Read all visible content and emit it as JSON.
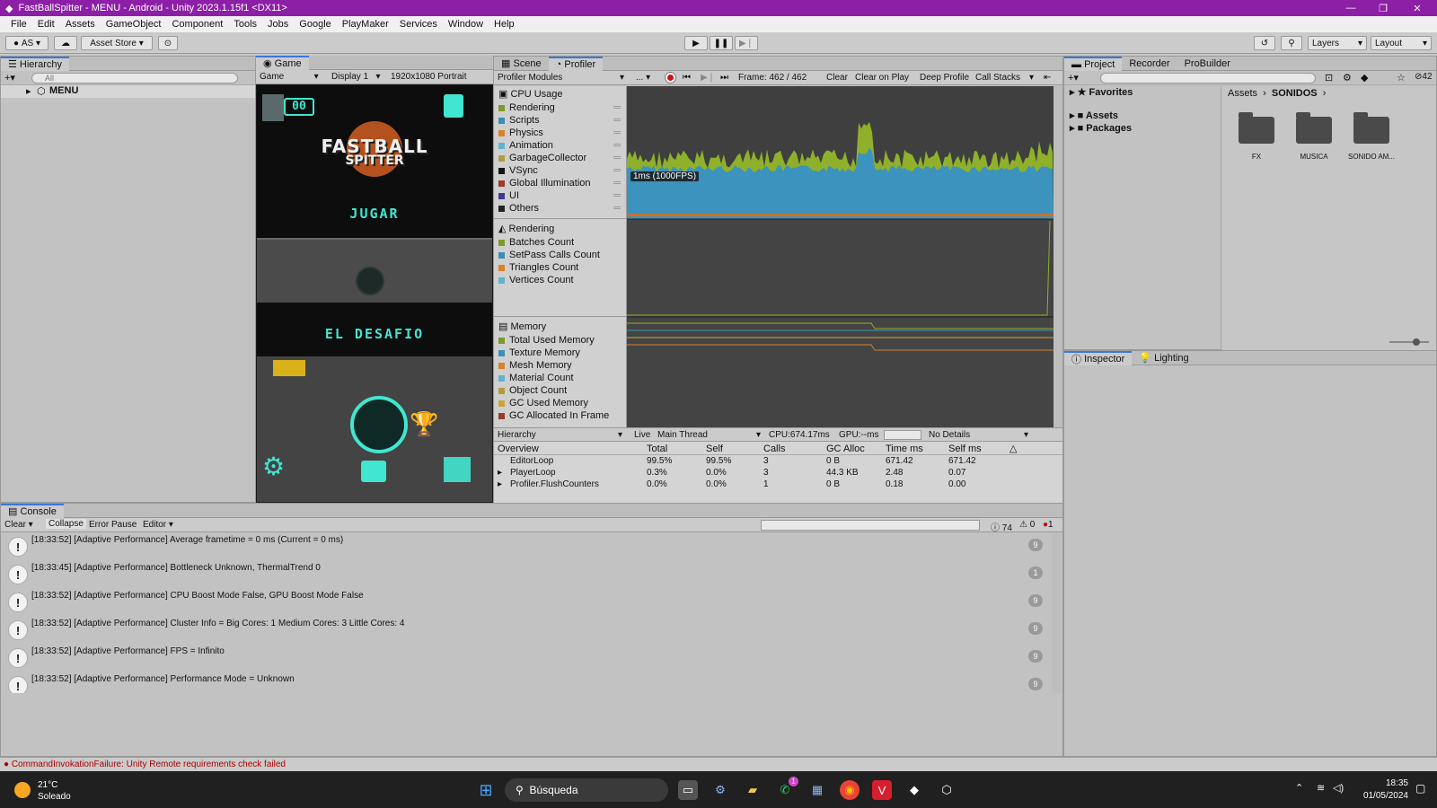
{
  "window": {
    "title": "FastBallSpitter - MENU - Android - Unity 2023.1.15f1 <DX11>"
  },
  "menu": [
    "File",
    "Edit",
    "Assets",
    "GameObject",
    "Component",
    "Tools",
    "Jobs",
    "Google",
    "PlayMaker",
    "Services",
    "Window",
    "Help"
  ],
  "toolbar": {
    "account": "AS",
    "asset_store": "Asset Store",
    "layers": "Layers",
    "layout": "Layout"
  },
  "hierarchy": {
    "tab": "Hierarchy",
    "search_placeholder": "All",
    "scene": "MENU"
  },
  "game": {
    "tab": "Game",
    "mode": "Game",
    "display": "Display 1",
    "resolution": "1920x1080 Portrait",
    "score": "00",
    "logo_line1": "FASTBALL",
    "logo_line2": "SPITTER",
    "play_button": "JUGAR",
    "challenge_button": "EL DESAFIO"
  },
  "profiler": {
    "tabs": [
      "Scene",
      "Profiler"
    ],
    "modules_label": "Profiler Modules",
    "frame": "Frame: 462 / 462",
    "clear": "Clear",
    "clear_on_play": "Clear on Play",
    "deep_profile": "Deep Profile",
    "call_stacks": "Call Stacks",
    "fps_label": "1ms (1000FPS)",
    "cpu": {
      "title": "CPU Usage",
      "items": [
        {
          "label": "Rendering",
          "color": "#7a9b2a"
        },
        {
          "label": "Scripts",
          "color": "#3a8fb5"
        },
        {
          "label": "Physics",
          "color": "#d9822b"
        },
        {
          "label": "Animation",
          "color": "#5fb3cf"
        },
        {
          "label": "GarbageCollector",
          "color": "#b39a3a"
        },
        {
          "label": "VSync",
          "color": "#111111"
        },
        {
          "label": "Global Illumination",
          "color": "#9a3b2a"
        },
        {
          "label": "UI",
          "color": "#3b3b8f"
        },
        {
          "label": "Others",
          "color": "#222222"
        }
      ]
    },
    "rendering": {
      "title": "Rendering",
      "items": [
        {
          "label": "Batches Count",
          "color": "#7a9b2a"
        },
        {
          "label": "SetPass Calls Count",
          "color": "#3a8fb5"
        },
        {
          "label": "Triangles Count",
          "color": "#d9822b"
        },
        {
          "label": "Vertices Count",
          "color": "#5fb3cf"
        }
      ]
    },
    "memory": {
      "title": "Memory",
      "items": [
        {
          "label": "Total Used Memory",
          "color": "#7a9b2a"
        },
        {
          "label": "Texture Memory",
          "color": "#3a8fb5"
        },
        {
          "label": "Mesh Memory",
          "color": "#d9822b"
        },
        {
          "label": "Material Count",
          "color": "#5fb3cf"
        },
        {
          "label": "Object Count",
          "color": "#b39a3a"
        },
        {
          "label": "GC Used Memory",
          "color": "#c9a63a"
        },
        {
          "label": "GC Allocated In Frame",
          "color": "#9a3b2a"
        }
      ]
    },
    "details_bar": {
      "view": "Hierarchy",
      "live": "Live",
      "thread": "Main Thread",
      "cpu": "CPU:674.17ms",
      "gpu": "GPU:--ms",
      "details": "No Details"
    },
    "columns": [
      "Overview",
      "Total",
      "Self",
      "Calls",
      "GC Alloc",
      "Time ms",
      "Self ms"
    ],
    "rows": [
      {
        "name": "EditorLoop",
        "total": "99.5%",
        "self": "99.5%",
        "calls": "3",
        "gc": "0 B",
        "time": "671.42",
        "selfms": "671.42"
      },
      {
        "name": "PlayerLoop",
        "total": "0.3%",
        "self": "0.0%",
        "calls": "3",
        "gc": "44.3 KB",
        "time": "2.48",
        "selfms": "0.07"
      },
      {
        "name": "Profiler.FlushCounters",
        "total": "0.0%",
        "self": "0.0%",
        "calls": "1",
        "gc": "0 B",
        "time": "0.18",
        "selfms": "0.00"
      }
    ]
  },
  "project": {
    "tabs": [
      "Project",
      "Recorder",
      "ProBuilder"
    ],
    "favorites": "Favorites",
    "tree": [
      "Assets",
      "Packages"
    ],
    "breadcrumb": [
      "Assets",
      "SONIDOS"
    ],
    "folders": [
      "FX",
      "MUSICA",
      "SONIDO AM..."
    ],
    "hidden_count": "42"
  },
  "inspector": {
    "tabs": [
      "Inspector",
      "Lighting"
    ]
  },
  "console": {
    "tab": "Console",
    "clear": "Clear",
    "collapse": "Collapse",
    "error_pause": "Error Pause",
    "editor": "Editor",
    "count_info": "74",
    "count_warn": "0",
    "count_error": "1",
    "rows": [
      {
        "msg": "[18:33:52] [Adaptive Performance] Average frametime = 0 ms (Current = 0 ms)",
        "count": "9"
      },
      {
        "msg": "[18:33:45] [Adaptive Performance] Bottleneck Unknown, ThermalTrend 0",
        "count": "1"
      },
      {
        "msg": "[18:33:52] [Adaptive Performance] CPU Boost Mode False, GPU Boost Mode False",
        "count": "9"
      },
      {
        "msg": "[18:33:52] [Adaptive Performance] Cluster Info = Big Cores: 1 Medium Cores: 3 Little Cores: 4",
        "count": "9"
      },
      {
        "msg": "[18:33:52] [Adaptive Performance] FPS = Infinito",
        "count": "9"
      },
      {
        "msg": "[18:33:52] [Adaptive Performance] Performance Mode = Unknown",
        "count": "9"
      }
    ]
  },
  "status": {
    "message": "CommandInvokationFailure: Unity Remote requirements check failed"
  },
  "taskbar": {
    "temp": "21°C",
    "weather": "Soleado",
    "search": "Búsqueda",
    "time": "18:35",
    "date": "01/05/2024",
    "whatsapp_badge": "1"
  }
}
